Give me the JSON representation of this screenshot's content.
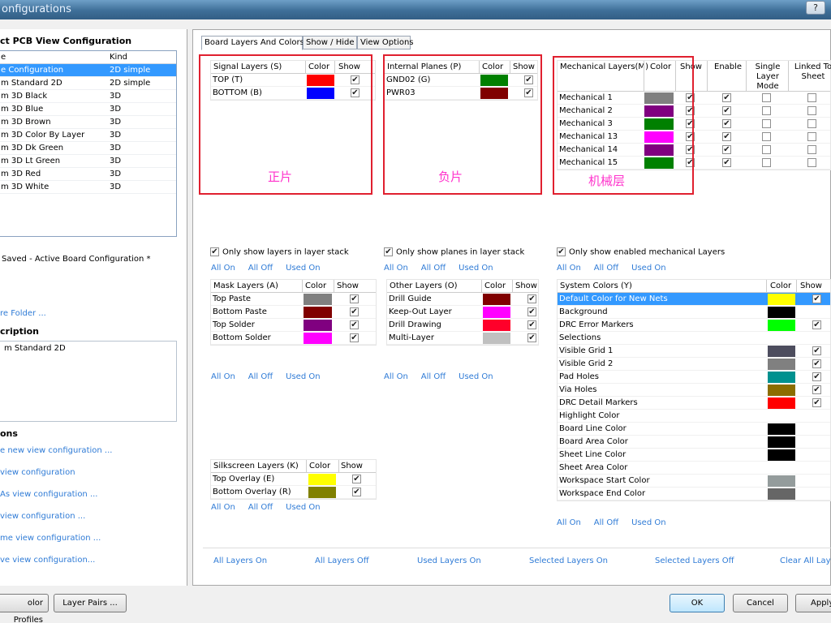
{
  "window": {
    "title": "onfigurations",
    "help": "?"
  },
  "left": {
    "select_title": "ct PCB View Configuration",
    "list_headers": {
      "name": "e",
      "kind": "Kind"
    },
    "configs": [
      {
        "name": "e Configuration",
        "kind": "2D simple"
      },
      {
        "name": "m Standard 2D",
        "kind": "2D simple"
      },
      {
        "name": "m 3D Black",
        "kind": "3D"
      },
      {
        "name": "m 3D Blue",
        "kind": "3D"
      },
      {
        "name": "m 3D Brown",
        "kind": "3D"
      },
      {
        "name": "m 3D Color By Layer",
        "kind": "3D"
      },
      {
        "name": "m 3D Dk Green",
        "kind": "3D"
      },
      {
        "name": "m 3D Lt Green",
        "kind": "3D"
      },
      {
        "name": "m 3D Red",
        "kind": "3D"
      },
      {
        "name": "m 3D White",
        "kind": "3D"
      }
    ],
    "saved_text": "Saved - Active Board Configuration *",
    "folder_link": "re Folder ...",
    "desc_title": "cription",
    "desc_text": "m Standard 2D",
    "actions_title": "ons",
    "actions": [
      "e new view configuration ...",
      "view configuration",
      "As view configuration ...",
      "view configuration ...",
      "me view configuration ...",
      "ve view configuration..."
    ]
  },
  "tabs": [
    "Board Layers And Colors",
    "Show / Hide",
    "View Options"
  ],
  "signal": {
    "h": "Signal Layers (S)",
    "color": "Color",
    "show": "Show",
    "rows": [
      {
        "name": "TOP (T)",
        "color": "#ff0000"
      },
      {
        "name": "BOTTOM (B)",
        "color": "#0000ff"
      }
    ],
    "option": "Only show layers in layer stack",
    "note": "正片"
  },
  "planes": {
    "h": "Internal Planes (P)",
    "color": "Color",
    "show": "Show",
    "rows": [
      {
        "name": "GND02 (G)",
        "color": "#008000"
      },
      {
        "name": "PWR03",
        "color": "#800000"
      }
    ],
    "option": "Only show planes in layer stack",
    "note": "负片"
  },
  "mech": {
    "h": "Mechanical Layers(M)",
    "color": "Color",
    "show": "Show",
    "enable": "Enable",
    "single": "Single Layer Mode",
    "linked": "Linked To Sheet",
    "rows": [
      {
        "name": "Mechanical 1",
        "color": "#808080"
      },
      {
        "name": "Mechanical 2",
        "color": "#800080"
      },
      {
        "name": "Mechanical 3",
        "color": "#008000"
      },
      {
        "name": "Mechanical 13",
        "color": "#ff00ff"
      },
      {
        "name": "Mechanical 14",
        "color": "#800080"
      },
      {
        "name": "Mechanical 15",
        "color": "#008000"
      }
    ],
    "option": "Only show enabled mechanical Layers",
    "note": "机械层"
  },
  "links": {
    "all_on": "All On",
    "all_off": "All Off",
    "used_on": "Used On"
  },
  "mask": {
    "h": "Mask Layers (A)",
    "color": "Color",
    "show": "Show",
    "rows": [
      {
        "name": "Top Paste",
        "color": "#808080"
      },
      {
        "name": "Bottom Paste",
        "color": "#800000"
      },
      {
        "name": "Top Solder",
        "color": "#800080"
      },
      {
        "name": "Bottom Solder",
        "color": "#ff00ff"
      }
    ]
  },
  "other": {
    "h": "Other Layers (O)",
    "color": "Color",
    "show": "Show",
    "rows": [
      {
        "name": "Drill Guide",
        "color": "#800000"
      },
      {
        "name": "Keep-Out Layer",
        "color": "#ff00ff"
      },
      {
        "name": "Drill Drawing",
        "color": "#ff002a"
      },
      {
        "name": "Multi-Layer",
        "color": "#c0c0c0"
      }
    ]
  },
  "silk": {
    "h": "Silkscreen Layers (K)",
    "color": "Color",
    "show": "Show",
    "rows": [
      {
        "name": "Top Overlay (E)",
        "color": "#ffff00"
      },
      {
        "name": "Bottom Overlay (R)",
        "color": "#808000"
      }
    ]
  },
  "system": {
    "h": "System Colors (Y)",
    "color": "Color",
    "show": "Show",
    "rows": [
      {
        "name": "Default Color for New Nets",
        "color": "#ffff00",
        "show": true
      },
      {
        "name": "Background",
        "color": "#000000",
        "show": null
      },
      {
        "name": "DRC Error Markers",
        "color": "#00ff00",
        "show": true
      },
      {
        "name": "Selections",
        "color": "#ffffff",
        "show": null
      },
      {
        "name": "Visible Grid 1",
        "color": "#4d4d5e",
        "show": true
      },
      {
        "name": "Visible Grid 2",
        "color": "#808080",
        "show": true
      },
      {
        "name": "Pad Holes",
        "color": "#00918f",
        "show": true
      },
      {
        "name": "Via Holes",
        "color": "#8b6d00",
        "show": true
      },
      {
        "name": "DRC Detail Markers",
        "color": "#ff0000",
        "show": true
      },
      {
        "name": "Highlight Color",
        "color": "#ffffff",
        "show": null
      },
      {
        "name": "Board Line Color",
        "color": "#000000",
        "show": null
      },
      {
        "name": "Board Area Color",
        "color": "#000000",
        "show": null
      },
      {
        "name": "Sheet Line Color",
        "color": "#000000",
        "show": null
      },
      {
        "name": "Sheet Area Color",
        "color": "#ffffff",
        "show": null
      },
      {
        "name": "Workspace Start Color",
        "color": "#949c9c",
        "show": null
      },
      {
        "name": "Workspace End Color",
        "color": "#666666",
        "show": null
      }
    ]
  },
  "bottom_links": [
    "All Layers On",
    "All Layers Off",
    "Used Layers On",
    "Selected Layers On",
    "Selected Layers Off",
    "Clear All Layer"
  ],
  "buttons": {
    "color_profiles": "olor Profiles",
    "layer_pairs": "Layer Pairs ...",
    "ok": "OK",
    "cancel": "Cancel",
    "apply": "Apply"
  }
}
